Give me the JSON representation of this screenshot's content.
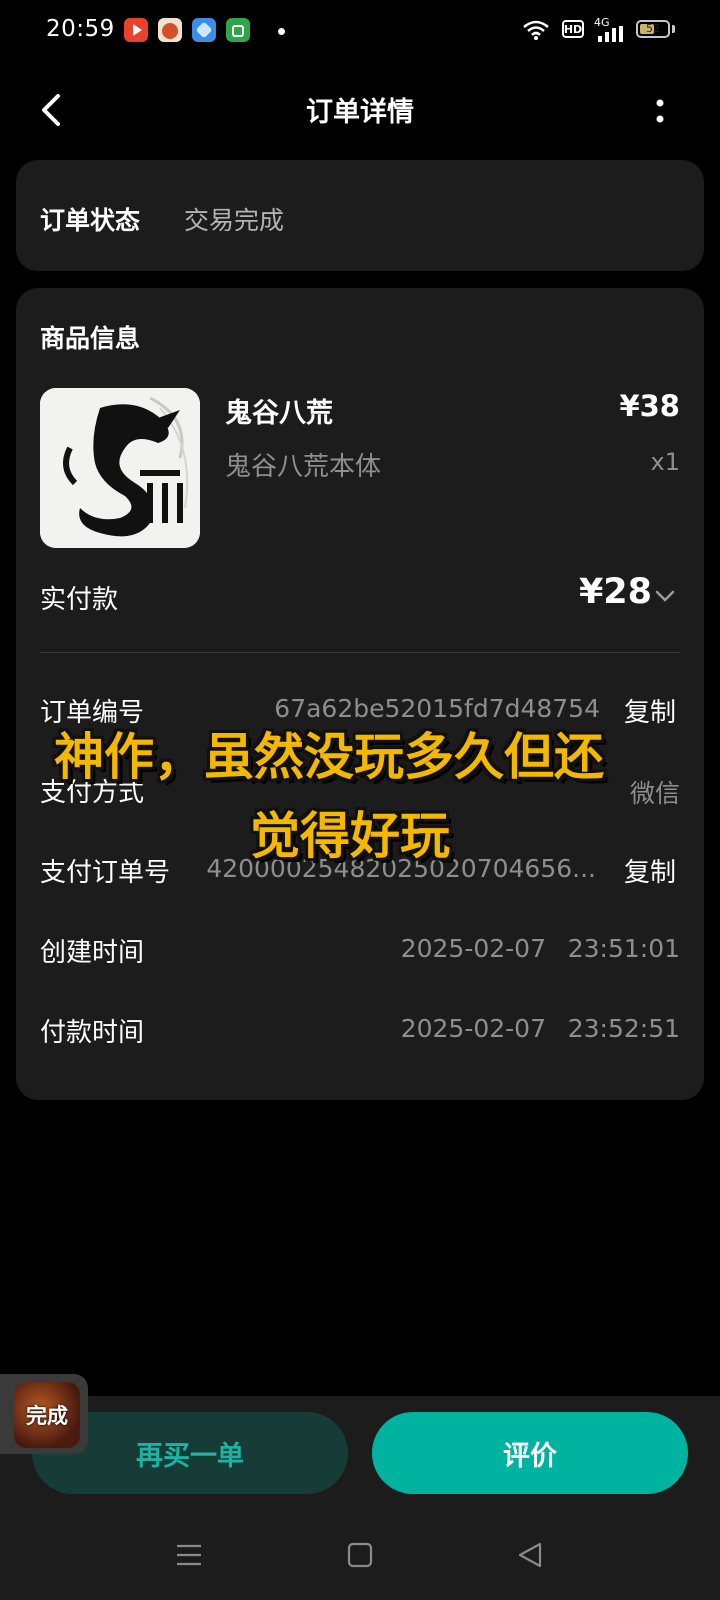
{
  "status_bar": {
    "time": "20:59",
    "app_icons": [
      {
        "name": "video-app-icon",
        "color": "#e8412e"
      },
      {
        "name": "game-app-icon",
        "color": "#d2502a"
      },
      {
        "name": "browser-app-icon",
        "color": "#3a8ee8"
      },
      {
        "name": "store-app-icon",
        "color": "#2fa54a"
      }
    ],
    "hd": "HD",
    "network": "4G",
    "battery": 52
  },
  "header": {
    "title": "订单详情"
  },
  "order_status": {
    "label": "订单状态",
    "value": "交易完成"
  },
  "goods": {
    "section_title": "商品信息",
    "name": "鬼谷八荒",
    "price": "¥38",
    "variant": "鬼谷八荒本体",
    "quantity": "x1"
  },
  "payment": {
    "label": "实付款",
    "value": "¥28"
  },
  "details": {
    "order_no": {
      "label": "订单编号",
      "value": "67a62be52015fd7d48754",
      "action": "复制"
    },
    "pay_method": {
      "label": "支付方式",
      "value": "微信"
    },
    "pay_order_no": {
      "label": "支付订单号",
      "value": "42000025482025020704656...",
      "action": "复制"
    },
    "created": {
      "label": "创建时间",
      "date": "2025-02-07",
      "time": "23:51:01"
    },
    "paid": {
      "label": "付款时间",
      "date": "2025-02-07",
      "time": "23:52:51"
    }
  },
  "caption": {
    "line1": "神作，虽然没玩多久但还",
    "line2": "觉得好玩"
  },
  "floating_badge": "完成",
  "actions": {
    "rebuy": "再买一单",
    "review": "评价"
  },
  "colors": {
    "accent": "#00b3a0",
    "caption": "#f5b800",
    "card": "#1c1c1c"
  }
}
